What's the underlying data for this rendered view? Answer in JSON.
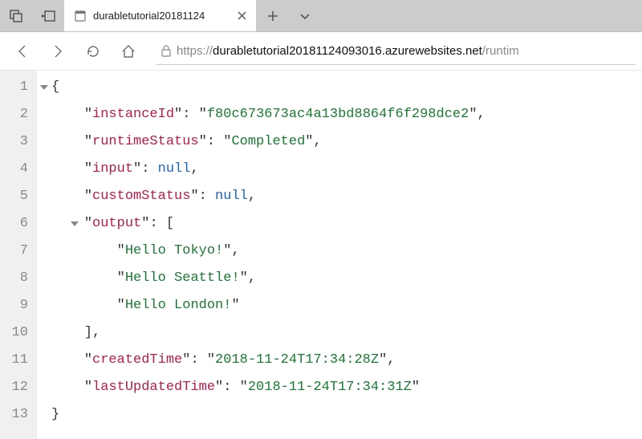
{
  "tab": {
    "title": "durabletutorial20181124"
  },
  "address": {
    "scheme": "https://",
    "host": "durabletutorial20181124093016.azurewebsites.net",
    "path": "/runtim"
  },
  "json": {
    "instanceId": "f80c673673ac4a13bd8864f6f298dce2",
    "runtimeStatus": "Completed",
    "input": "null",
    "customStatus": "null",
    "outputLabel": "output",
    "output": [
      "Hello Tokyo!",
      "Hello Seattle!",
      "Hello London!"
    ],
    "createdTime": "2018-11-24T17:34:28Z",
    "lastUpdatedTime": "2018-11-24T17:34:31Z"
  },
  "lineNumbers": [
    "1",
    "2",
    "3",
    "4",
    "5",
    "6",
    "7",
    "8",
    "9",
    "10",
    "11",
    "12",
    "13"
  ],
  "keys": {
    "instanceId": "instanceId",
    "runtimeStatus": "runtimeStatus",
    "input": "input",
    "customStatus": "customStatus",
    "output": "output",
    "createdTime": "createdTime",
    "lastUpdatedTime": "lastUpdatedTime"
  }
}
